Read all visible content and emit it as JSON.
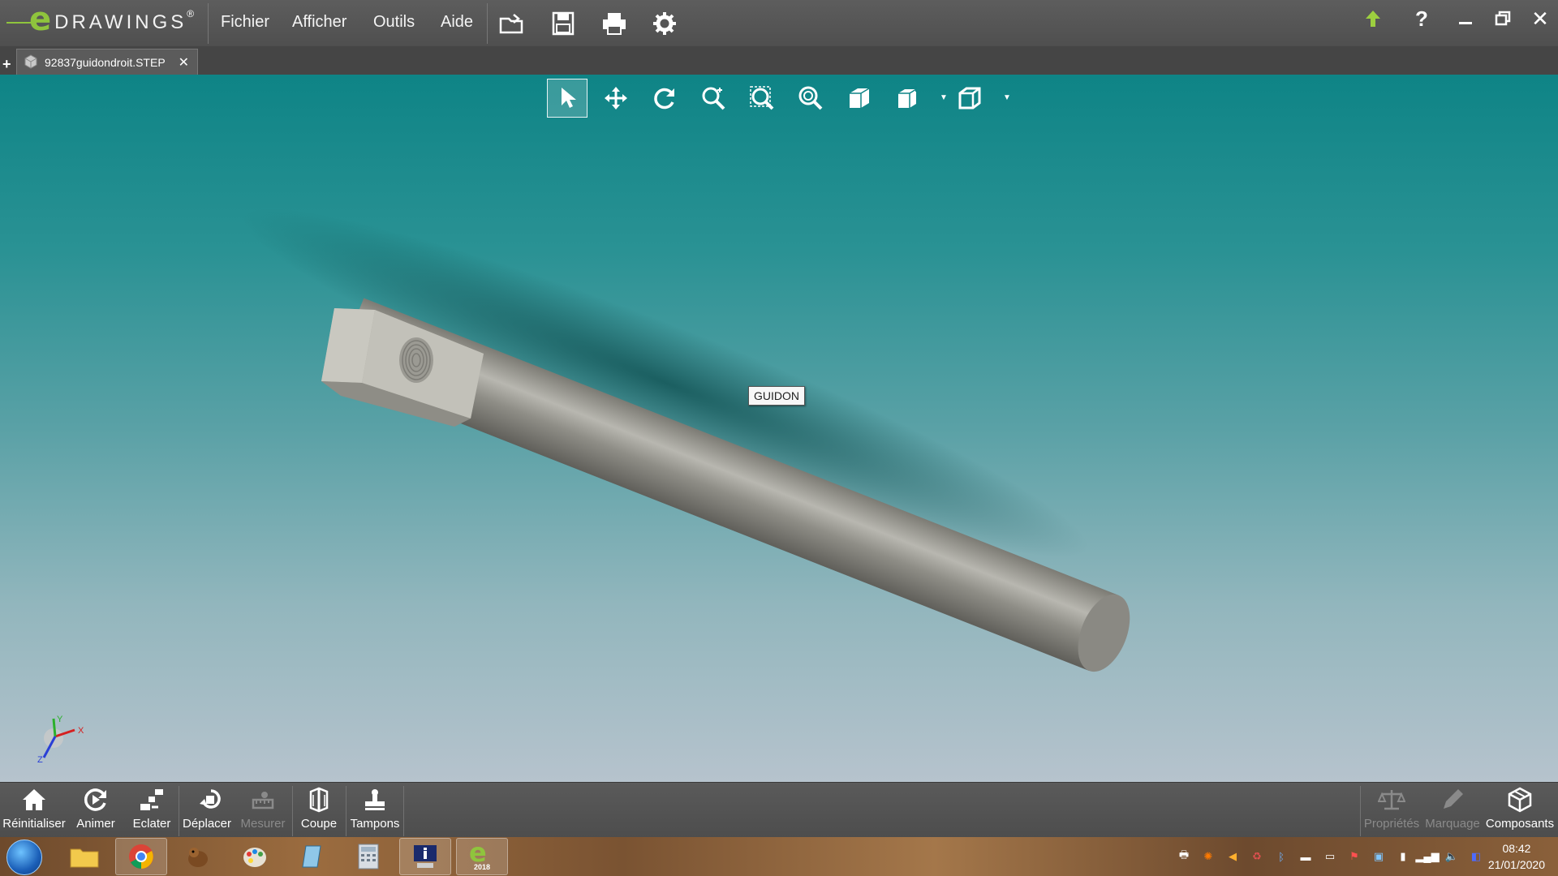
{
  "app": {
    "logo_letter": "e",
    "logo_word": "DRAWINGS",
    "logo_mark": "®"
  },
  "menu": {
    "items": [
      "Fichier",
      "Afficher",
      "Outils",
      "Aide"
    ]
  },
  "toolbar_icons": [
    "open-folder-icon",
    "save-icon",
    "print-icon",
    "settings-gear-icon"
  ],
  "window_controls": {
    "upgrade": "upgrade-arrow-icon",
    "help": "?",
    "minimize": "minimize-icon",
    "restore": "restore-icon",
    "close": "✕"
  },
  "tabs": {
    "add": "+",
    "document": {
      "title": "92837guidondroit.STEP",
      "close": "✕"
    }
  },
  "view_tools": [
    "select-arrow-icon",
    "pan-icon",
    "rotate-icon",
    "zoom-to-fit-icon",
    "zoom-to-area-icon",
    "zoom-icon",
    "shaded-view-icon",
    "view-orientation-icon",
    "display-style-icon"
  ],
  "model": {
    "component_label": "GUIDON"
  },
  "triad": {
    "x_label": "X",
    "y_label": "Y",
    "z_label": "Z"
  },
  "commands_left": [
    {
      "label": "Réinitialiser",
      "icon": "home-icon",
      "enabled": true
    },
    {
      "label": "Animer",
      "icon": "animate-icon",
      "enabled": true
    },
    {
      "label": "Eclater",
      "icon": "explode-icon",
      "enabled": true
    },
    {
      "label": "Déplacer",
      "icon": "move-component-icon",
      "enabled": true
    },
    {
      "label": "Mesurer",
      "icon": "measure-icon",
      "enabled": false
    },
    {
      "label": "Coupe",
      "icon": "section-icon",
      "enabled": true
    },
    {
      "label": "Tampons",
      "icon": "stamp-icon",
      "enabled": true
    }
  ],
  "commands_right": [
    {
      "label": "Propriétés",
      "icon": "properties-scale-icon",
      "enabled": false
    },
    {
      "label": "Marquage",
      "icon": "markup-pencil-icon",
      "enabled": false
    },
    {
      "label": "Composants",
      "icon": "components-icon",
      "enabled": true
    }
  ],
  "taskbar": {
    "apps": [
      "explorer",
      "chrome",
      "paint-dog",
      "paint",
      "notepad",
      "calculator",
      "info-app",
      "edrawings-2018"
    ],
    "edrawings_badge": "2018",
    "clock_time": "08:42",
    "clock_date": "21/01/2020"
  },
  "colors": {
    "accent_green": "#8fc43d",
    "viewport_top": "#0e8486",
    "viewport_bottom": "#b6c3cd"
  }
}
